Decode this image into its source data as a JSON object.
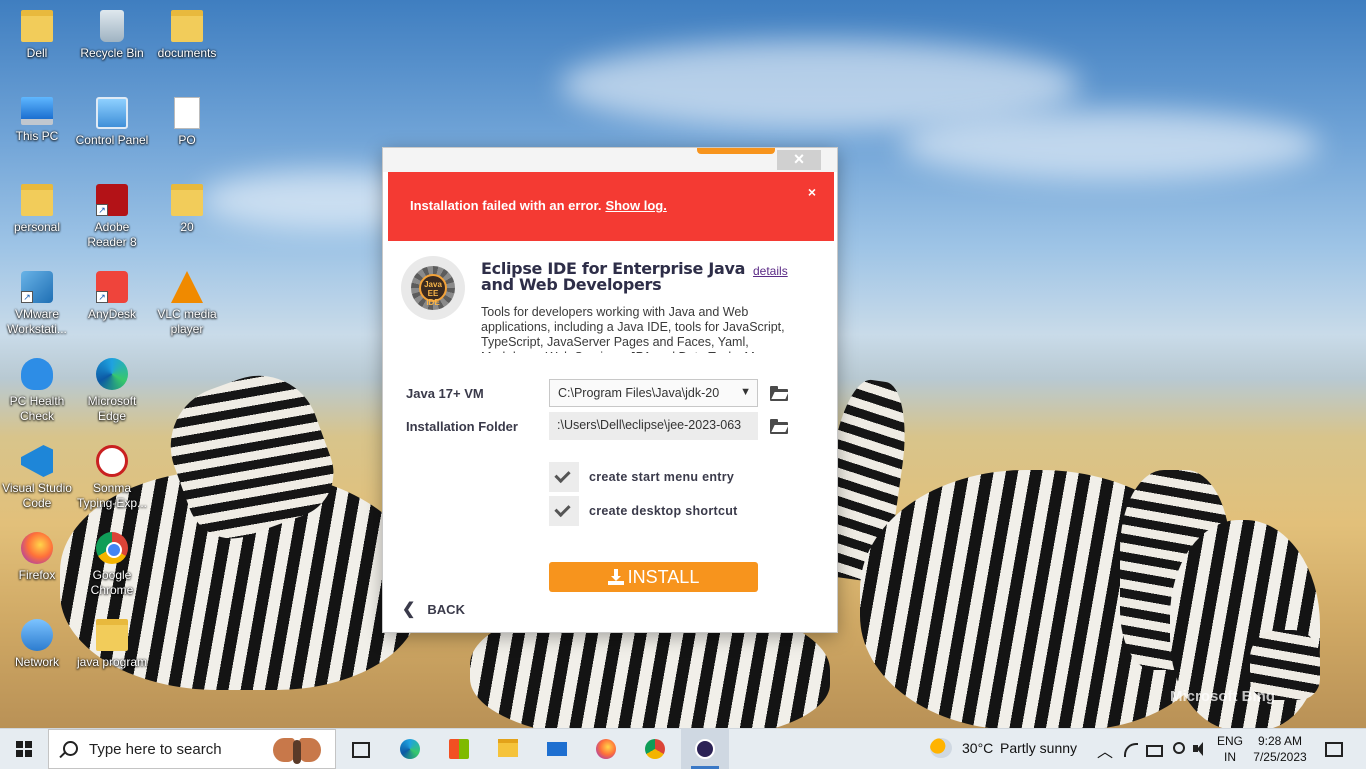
{
  "desktop": {
    "icons": [
      {
        "label": "Dell",
        "icon": "user-folder-icon"
      },
      {
        "label": "Recycle Bin",
        "icon": "recycle-bin-icon"
      },
      {
        "label": "documents",
        "icon": "folder-icon"
      },
      {
        "label": "This PC",
        "icon": "computer-icon"
      },
      {
        "label": "Control Panel",
        "icon": "control-panel-icon"
      },
      {
        "label": "PO",
        "icon": "document-icon"
      },
      {
        "label": "personal",
        "icon": "folder-icon"
      },
      {
        "label": "Adobe Reader 8",
        "icon": "adobe-reader-icon"
      },
      {
        "label": "20",
        "icon": "folder-icon"
      },
      {
        "label": "VMware Workstati...",
        "icon": "vmware-icon"
      },
      {
        "label": "AnyDesk",
        "icon": "anydesk-icon"
      },
      {
        "label": "VLC media player",
        "icon": "vlc-icon"
      },
      {
        "label": "PC Health Check",
        "icon": "health-check-icon"
      },
      {
        "label": "Microsoft Edge",
        "icon": "edge-icon"
      },
      {
        "label": "Visual Studio Code",
        "icon": "vscode-icon"
      },
      {
        "label": "Sonma Typing-Exp...",
        "icon": "sonma-icon"
      },
      {
        "label": "Firefox",
        "icon": "firefox-icon"
      },
      {
        "label": "Google Chrome",
        "icon": "chrome-icon"
      },
      {
        "label": "Network",
        "icon": "network-icon"
      },
      {
        "label": "java program",
        "icon": "folder-icon"
      }
    ],
    "watermark": "Microsoft Bing"
  },
  "installer": {
    "error": {
      "message": "Installation failed with an error.",
      "link": "Show log.",
      "close": "×"
    },
    "window_close": "×",
    "product": {
      "logo_text": "Java EE IDE",
      "title": "Eclipse IDE for Enterprise Java and Web Developers",
      "details_link": "details",
      "description": "Tools for developers working with Java and Web applications, including a Java IDE, tools for JavaScript, TypeScript, JavaServer Pages and Faces, Yaml, Markdown, Web Services, JPA and Data Tools, Maven and Gradle, Git, and more."
    },
    "java_vm": {
      "label": "Java 17+ VM",
      "value": "C:\\Program Files\\Java\\jdk-20"
    },
    "install_folder": {
      "label": "Installation Folder",
      "value": ":\\Users\\Dell\\eclipse\\jee-2023-063"
    },
    "options": [
      {
        "label": "create start menu entry",
        "checked": true
      },
      {
        "label": "create desktop shortcut",
        "checked": true
      }
    ],
    "install_button": "INSTALL",
    "back_button": "BACK",
    "colors": {
      "error_red": "#f43a33",
      "accent_orange": "#f7941d"
    }
  },
  "taskbar": {
    "search_placeholder": "Type here to search",
    "pinned": [
      "task-view-icon",
      "edge-icon",
      "store-icon",
      "file-explorer-icon",
      "mail-icon",
      "firefox-icon",
      "chrome-icon",
      "eclipse-installer-icon"
    ],
    "weather": {
      "temp": "30°C",
      "condition": "Partly sunny"
    },
    "language": {
      "line1": "ENG",
      "line2": "IN"
    },
    "clock": {
      "time": "9:28 AM",
      "date": "7/25/2023"
    }
  }
}
